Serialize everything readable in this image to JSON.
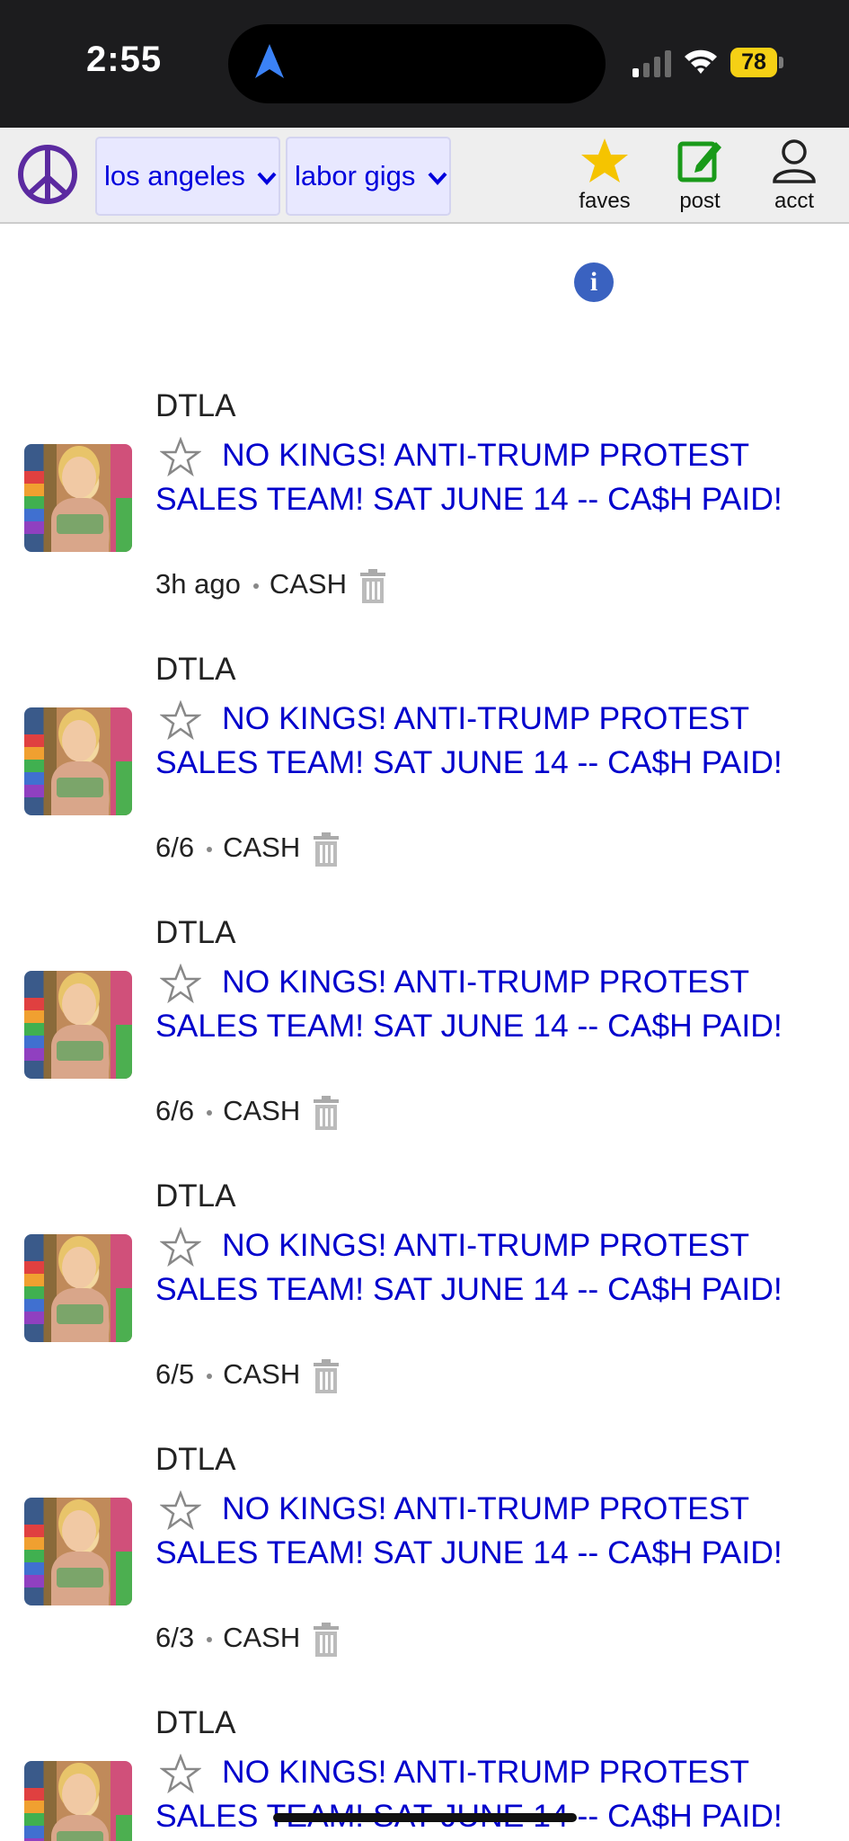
{
  "status_bar": {
    "time": "2:55",
    "battery": "78",
    "icons": [
      "location-arrow-icon",
      "cellular-signal-icon",
      "wifi-icon",
      "battery-icon"
    ]
  },
  "header": {
    "logo_icon": "peace-sign-icon",
    "area_dropdown": "los angeles",
    "category_dropdown": "labor gigs",
    "faves_label": "faves",
    "post_label": "post",
    "acct_label": "acct",
    "colors": {
      "link": "#0000cc",
      "star": "#f5c400",
      "post": "#1a9a1a",
      "logo": "#5b2aa0",
      "info": "#3a62c0"
    }
  },
  "listings": [
    {
      "location": "DTLA",
      "title": "NO KINGS! ANTI-TRUMP PROTEST SALES TEAM! SAT JUNE 14 -- CA$H PAID!",
      "date": "3h ago",
      "pay": "CASH"
    },
    {
      "location": "DTLA",
      "title": "NO KINGS! ANTI-TRUMP PROTEST SALES TEAM! SAT JUNE 14 -- CA$H PAID!",
      "date": "6/6",
      "pay": "CASH"
    },
    {
      "location": "DTLA",
      "title": "NO KINGS! ANTI-TRUMP PROTEST SALES TEAM! SAT JUNE 14 -- CA$H PAID!",
      "date": "6/6",
      "pay": "CASH"
    },
    {
      "location": "DTLA",
      "title": "NO KINGS! ANTI-TRUMP PROTEST SALES TEAM! SAT JUNE 14 -- CA$H PAID!",
      "date": "6/5",
      "pay": "CASH"
    },
    {
      "location": "DTLA",
      "title": "NO KINGS! ANTI-TRUMP PROTEST SALES TEAM! SAT JUNE 14 -- CA$H PAID!",
      "date": "6/3",
      "pay": "CASH"
    },
    {
      "location": "DTLA",
      "title": "NO KINGS! ANTI-TRUMP PROTEST SALES TEAM! SAT JUNE 14 -- CA$H PAID!",
      "date": "",
      "pay": ""
    }
  ]
}
